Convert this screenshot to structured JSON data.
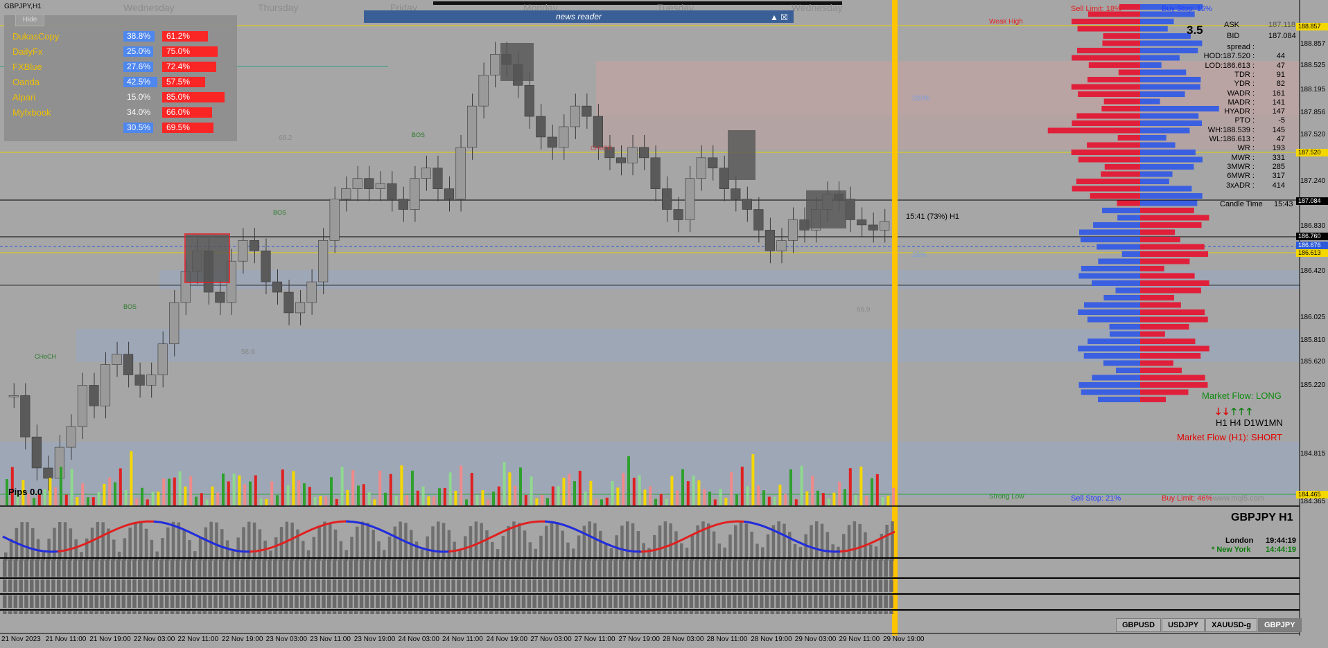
{
  "symbol_title": "GBPJPY,H1",
  "day_labels": [
    "Wednesday",
    "Thursday",
    "Friday",
    "Monday",
    "Tuesday",
    "Wednesday"
  ],
  "sentiment": {
    "hide_label": "Hide",
    "rows": [
      {
        "name": "DukasCopy",
        "buy": "38.8%",
        "sell": "61.2%"
      },
      {
        "name": "DailyFx",
        "buy": "25.0%",
        "sell": "75.0%"
      },
      {
        "name": "FXBlue",
        "buy": "27.6%",
        "sell": "72.4%"
      },
      {
        "name": "Oanda",
        "buy": "42.5%",
        "sell": "57.5%"
      },
      {
        "name": "Alpari",
        "buy": "15.0%",
        "sell": "85.0%"
      },
      {
        "name": "Myfxbook",
        "buy": "34.0%",
        "sell": "66.0%"
      },
      {
        "name": "",
        "buy": "30.5%",
        "sell": "69.5%"
      }
    ]
  },
  "news_reader": {
    "title": "news reader",
    "controls": "▲ ☒"
  },
  "levels": {
    "sell_limit": "Sell Limit: 18%",
    "buy_stop": "Buy Stop: 15%",
    "sell_stop": "Sell Stop: 21%",
    "buy_limit": "Buy Limit: 46%",
    "weak_high": "Weak High",
    "strong_low": "Strong Low",
    "watermark": "www.mql5.com"
  },
  "info": {
    "spread_big": "3.5",
    "ask_label": "ASK",
    "ask": "187.118",
    "bid_label": "BID",
    "bid": "187.084",
    "rows": [
      {
        "label": "spread :",
        "value": ""
      },
      {
        "label": "HOD:187.520 :",
        "value": "44"
      },
      {
        "label": "LOD:186.613 :",
        "value": "47"
      },
      {
        "label": "TDR :",
        "value": "91"
      },
      {
        "label": "YDR :",
        "value": "82"
      },
      {
        "label": "WADR :",
        "value": "161"
      },
      {
        "label": "MADR :",
        "value": "141"
      },
      {
        "label": "HYADR :",
        "value": "147"
      },
      {
        "label": "PTO :",
        "value": "-5"
      },
      {
        "label": "WH:188.539 :",
        "value": "145"
      },
      {
        "label": "WL:186.613 :",
        "value": "47"
      },
      {
        "label": "WR :",
        "value": "193"
      },
      {
        "label": "MWR :",
        "value": "331"
      },
      {
        "label": "3MWR :",
        "value": "285"
      },
      {
        "label": "6MWR :",
        "value": "317"
      },
      {
        "label": "3xADR :",
        "value": "414"
      }
    ],
    "candle_time_label": "Candle Time",
    "candle_time": "15:43",
    "candle_note": "15:41 (73%) H1"
  },
  "market_flow": {
    "long": "Market Flow: LONG",
    "tfs": "H1 H4 D1W1MN",
    "short": "Market Flow (H1): SHORT",
    "arrows": [
      "down",
      "down",
      "up",
      "up",
      "up"
    ]
  },
  "pips_label": "Pips 0.0",
  "pair_title": "GBPJPY  H1",
  "clock": {
    "city1": "London",
    "time1": "19:44:19",
    "city2": "* New York",
    "time2": "14:44:19"
  },
  "annotations": {
    "choch1": "CHoCH",
    "bos1": "BOS",
    "bos2": "BOS",
    "bos3": "BOS",
    "choch2": "CHoCH",
    "fib1": "66.2",
    "fib2": "58.9",
    "fib3": "66.9",
    "pct1": "23%",
    "pct2": "233%"
  },
  "y_axis": [
    "188.857",
    "188.525",
    "188.195",
    "187.856",
    "187.520",
    "187.240",
    "186.830",
    "186.420",
    "186.025",
    "185.810",
    "185.620",
    "185.220",
    "184.815",
    "184.365"
  ],
  "price_boxes": [
    {
      "label": "188.857",
      "color": "#f5d800"
    },
    {
      "label": "187.520",
      "color": "#f5d800"
    },
    {
      "label": "187.084",
      "color": "#000000",
      "text": "#ffffff"
    },
    {
      "label": "186.760",
      "color": "#000000",
      "text": "#ffffff"
    },
    {
      "label": "186.676",
      "color": "#2a59d9",
      "text": "#ffffff"
    },
    {
      "label": "186.613",
      "color": "#f5d800"
    },
    {
      "label": "184.465",
      "color": "#f5d800"
    }
  ],
  "x_axis": [
    "21 Nov 2023",
    "21 Nov 11:00",
    "21 Nov 19:00",
    "22 Nov 03:00",
    "22 Nov 11:00",
    "22 Nov 19:00",
    "23 Nov 03:00",
    "23 Nov 11:00",
    "23 Nov 19:00",
    "24 Nov 03:00",
    "24 Nov 11:00",
    "24 Nov 19:00",
    "27 Nov 03:00",
    "27 Nov 11:00",
    "27 Nov 19:00",
    "28 Nov 03:00",
    "28 Nov 11:00",
    "28 Nov 19:00",
    "29 Nov 03:00",
    "29 Nov 11:00",
    "29 Nov 19:00"
  ],
  "symbol_tabs": [
    "GBPUSD",
    "USDJPY",
    "XAUUSD-g",
    "GBPJPY"
  ],
  "active_tab": "GBPJPY",
  "chart_data": {
    "type": "candlestick",
    "title": "GBPJPY,H1",
    "ylim": [
      184.365,
      188.857
    ],
    "series": [
      {
        "name": "GBPJPY H1",
        "values": [
          185.4,
          185.0,
          184.7,
          184.6,
          184.9,
          185.1,
          185.5,
          185.3,
          185.7,
          185.8,
          185.6,
          185.5,
          185.6,
          185.9,
          186.3,
          186.6,
          186.8,
          186.4,
          186.3,
          186.7,
          186.9,
          186.8,
          186.5,
          186.4,
          186.2,
          186.3,
          186.5,
          186.9,
          187.3,
          187.4,
          187.5,
          187.4,
          187.45,
          187.3,
          187.2,
          187.5,
          187.6,
          187.4,
          187.3,
          187.8,
          188.2,
          188.5,
          188.7,
          188.6,
          188.4,
          188.1,
          187.9,
          187.8,
          188.0,
          188.2,
          188.1,
          187.8,
          187.7,
          187.65,
          187.8,
          187.7,
          187.4,
          187.2,
          187.1,
          187.5,
          187.7,
          187.6,
          187.4,
          187.3,
          187.2,
          187.0,
          186.8,
          186.9,
          187.1,
          187.0,
          187.2,
          187.35,
          187.3,
          187.1,
          187.05,
          187.0,
          187.084
        ]
      }
    ]
  }
}
